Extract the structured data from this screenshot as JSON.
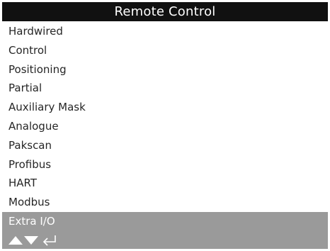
{
  "header": {
    "title": "Remote Control"
  },
  "menu": {
    "items": [
      {
        "label": "Hardwired"
      },
      {
        "label": "Control"
      },
      {
        "label": "Positioning"
      },
      {
        "label": "Partial"
      },
      {
        "label": "Auxiliary Mask"
      },
      {
        "label": "Analogue"
      },
      {
        "label": "Pakscan"
      },
      {
        "label": "Profibus"
      },
      {
        "label": "HART"
      },
      {
        "label": "Modbus"
      },
      {
        "label": "Extra I/O",
        "selected": true
      }
    ]
  },
  "footer": {
    "icons": [
      "up-arrow-icon",
      "down-arrow-icon",
      "enter-return-icon"
    ]
  },
  "colors": {
    "header_bg": "#111111",
    "header_text": "#ffffff",
    "item_text": "#262626",
    "selected_bg": "#9a9a9a",
    "selected_text": "#ffffff",
    "footer_bg": "#9a9a9a"
  }
}
